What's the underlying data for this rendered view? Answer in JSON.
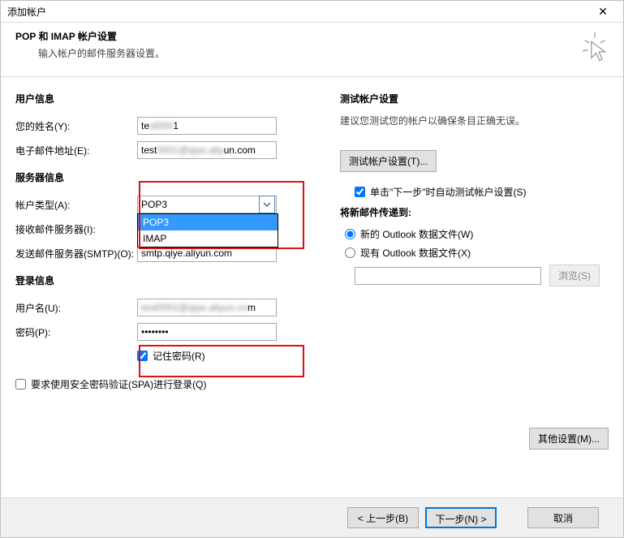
{
  "window": {
    "title": "添加帐户"
  },
  "header": {
    "title": "POP 和 IMAP 帐户设置",
    "subtitle": "输入帐户的邮件服务器设置。"
  },
  "sections": {
    "user_info": "用户信息",
    "server_info": "服务器信息",
    "login_info": "登录信息",
    "test_settings": "测试帐户设置",
    "deliver_to": "将新邮件传递到:"
  },
  "labels": {
    "your_name": "您的姓名(Y):",
    "email": "电子邮件地址(E):",
    "account_type": "帐户类型(A):",
    "incoming": "接收邮件服务器(I):",
    "outgoing": "发送邮件服务器(SMTP)(O):",
    "username": "用户名(U):",
    "password": "密码(P):",
    "remember_pw": "记住密码(R)",
    "spa": "要求使用安全密码验证(SPA)进行登录(Q)",
    "auto_test": "单击\"下一步\"时自动测试帐户设置(S)",
    "new_pst": "新的 Outlook 数据文件(W)",
    "existing_pst": "现有 Outlook 数据文件(X)"
  },
  "values": {
    "your_name_prefix": "te",
    "your_name_suffix": "1",
    "email_prefix": "test",
    "email_suffix": "un.com",
    "account_type_selected": "POP3",
    "dropdown_options": [
      "POP3",
      "IMAP"
    ],
    "incoming": "",
    "outgoing": "smtp.qiye.aliyun.com",
    "username_suffix": "m",
    "password": "********",
    "remember_pw_checked": true,
    "spa_checked": false,
    "auto_test_checked": true,
    "deliver_to_selected": "new"
  },
  "hints": {
    "test_hint": "建议您测试您的帐户以确保条目正确无误。"
  },
  "buttons": {
    "test": "测试帐户设置(T)...",
    "browse": "浏览(S)",
    "more": "其他设置(M)...",
    "back": "< 上一步(B)",
    "next": "下一步(N) >",
    "cancel": "取消"
  }
}
